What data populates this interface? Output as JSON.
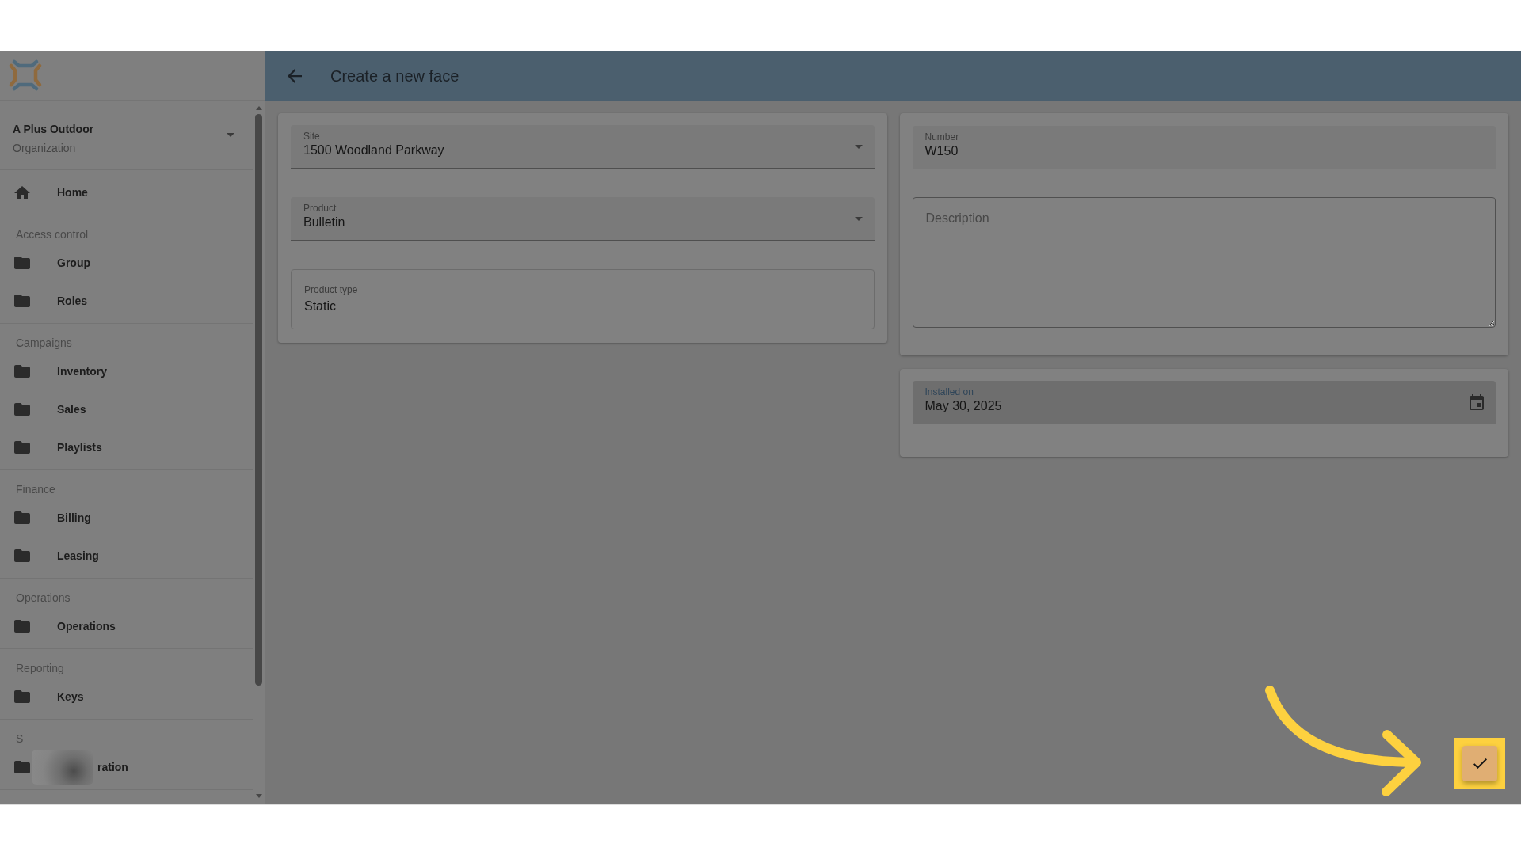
{
  "sidebar": {
    "organization": {
      "name": "A Plus Outdoor",
      "type": "Organization"
    },
    "home": {
      "label": "Home"
    },
    "sections": [
      {
        "heading": "Access control",
        "items": [
          {
            "label": "Group",
            "blurred": false
          },
          {
            "label": "Roles",
            "blurred": false
          }
        ]
      },
      {
        "heading": "Campaigns",
        "items": [
          {
            "label": "Inventory",
            "blurred": false
          },
          {
            "label": "Sales",
            "blurred": false
          },
          {
            "label": "Playlists",
            "blurred": false
          }
        ]
      },
      {
        "heading": "Finance",
        "items": [
          {
            "label": "Billing",
            "blurred": false
          },
          {
            "label": "Leasing",
            "blurred": false
          }
        ]
      },
      {
        "heading": "Operations",
        "items": [
          {
            "label": "Operations",
            "blurred": false
          }
        ]
      },
      {
        "heading": "Reporting",
        "items": [
          {
            "label": "Keys",
            "blurred": false
          }
        ]
      },
      {
        "heading": "S",
        "items": [
          {
            "label": "ration",
            "blurred": true
          }
        ]
      }
    ]
  },
  "header": {
    "title": "Create a new face"
  },
  "columns": [
    {
      "cards": [
        {
          "fields": [
            {
              "kind": "select",
              "label": "Site",
              "value": "1500 Woodland Parkway",
              "focused": false
            },
            {
              "kind": "select",
              "label": "Product",
              "value": "Bulletin",
              "focused": false
            },
            {
              "kind": "outlined",
              "label": "Product type",
              "value": "Static",
              "focused": false
            }
          ]
        }
      ]
    },
    {
      "cards": [
        {
          "fields": [
            {
              "kind": "text",
              "label": "Number",
              "value": "W150",
              "focused": false
            },
            {
              "kind": "textarea",
              "placeholder": "Description",
              "focused": false
            }
          ]
        },
        {
          "fields": [
            {
              "kind": "date",
              "label": "Installed on",
              "value": "May 30, 2025",
              "focused": true
            }
          ]
        }
      ]
    }
  ]
}
